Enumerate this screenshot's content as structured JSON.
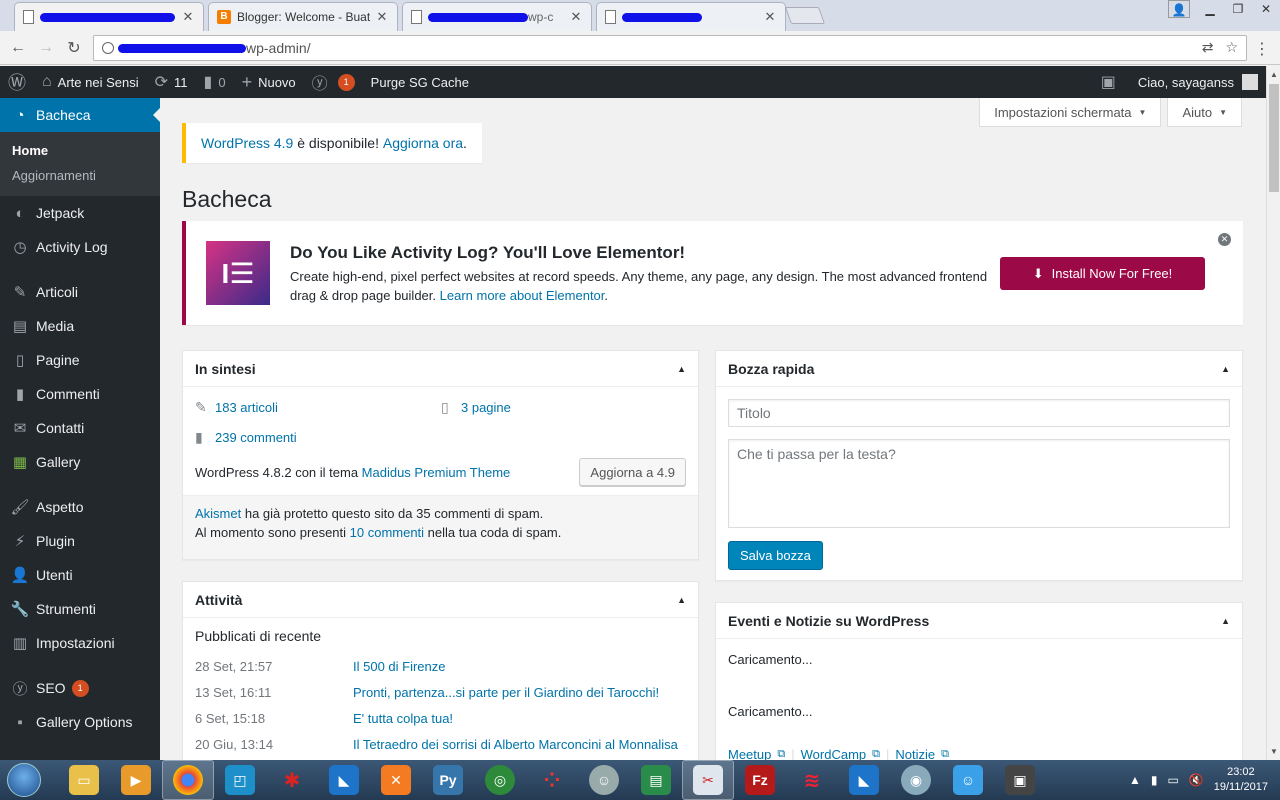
{
  "browser": {
    "tabs": [
      {
        "title": "",
        "favicon": "page-icon",
        "redacted": true
      },
      {
        "title": "Blogger: Welcome - Buat",
        "favicon": "blogger-icon",
        "redacted": false
      },
      {
        "title": "wp-c",
        "favicon": "page-icon",
        "redacted": true
      },
      {
        "title": "",
        "favicon": "page-icon",
        "redacted": true
      }
    ],
    "url": "wp-admin/"
  },
  "adminbar": {
    "site_name": "Arte nei Sensi",
    "updates_count": "11",
    "comments_count": "0",
    "new_label": "Nuovo",
    "seo_badge": "1",
    "purge_label": "Purge SG Cache",
    "greeting": "Ciao, sayaganss"
  },
  "sidebar": {
    "current": "Bacheca",
    "submenu": [
      "Home",
      "Aggiornamenti"
    ],
    "items_a": [
      "Jetpack",
      "Activity Log"
    ],
    "items_b": [
      "Articoli",
      "Media",
      "Pagine",
      "Commenti",
      "Contatti",
      "Gallery"
    ],
    "items_c": [
      "Aspetto",
      "Plugin",
      "Utenti",
      "Strumenti",
      "Impostazioni"
    ],
    "seo_label": "SEO",
    "seo_badge": "1",
    "gallery_options": "Gallery Options"
  },
  "screen": {
    "options_label": "Impostazioni schermata",
    "help_label": "Aiuto"
  },
  "nag": {
    "version_link": "WordPress 4.9",
    "middle": " è disponibile! ",
    "update_link": "Aggiorna ora",
    "end": "."
  },
  "page_title": "Bacheca",
  "elementor": {
    "title": "Do You Like Activity Log? You'll Love Elementor!",
    "desc": "Create high-end, pixel perfect websites at record speeds. Any theme, any page, any design. The most advanced frontend drag & drop page builder.",
    "learn_link": "Learn more about Elementor",
    "end": ".",
    "button": "Install Now For Free!"
  },
  "glance": {
    "title": "In sintesi",
    "posts": "183 articoli",
    "pages": "3 pagine",
    "comments": "239 commenti",
    "wp_text": "WordPress 4.8.2 con il tema ",
    "theme_link": "Madidus Premium Theme",
    "update_btn": "Aggiorna a 4.9",
    "akismet_link": "Akismet",
    "akismet_text1": " ha già protetto questo sito da 35 commenti di spam.",
    "akismet_text2": "Al momento sono presenti ",
    "akismet_spam_link": "10 commenti",
    "akismet_text3": " nella tua coda di spam."
  },
  "draft": {
    "title": "Bozza rapida",
    "title_placeholder": "Titolo",
    "content_placeholder": "Che ti passa per la testa?",
    "save": "Salva bozza"
  },
  "activity": {
    "title": "Attività",
    "subtitle": "Pubblicati di recente",
    "rows": [
      {
        "date": "28 Set, 21:57",
        "title": "Il 500 di Firenze"
      },
      {
        "date": "13 Set, 16:11",
        "title": "Pronti, partenza...si parte per il Giardino dei Tarocchi!"
      },
      {
        "date": "6 Set, 15:18",
        "title": "E' tutta colpa tua!"
      },
      {
        "date": "20 Giu, 13:14",
        "title": "Il Tetraedro dei sorrisi di Alberto Marconcini al Monnalisa"
      }
    ]
  },
  "events": {
    "title": "Eventi e Notizie su WordPress",
    "loading1": "Caricamento...",
    "loading2": "Caricamento...",
    "links": [
      "Meetup",
      "WordCamp",
      "Notizie"
    ]
  },
  "taskbar": {
    "time": "23:02",
    "date": "19/11/2017"
  }
}
